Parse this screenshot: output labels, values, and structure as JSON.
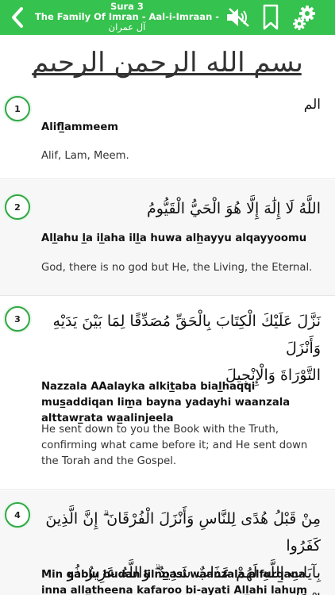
{
  "header": {
    "sura_label": "Sura 3",
    "title_en": "The Family Of Imran - Aal-i-Imraan -",
    "title_ar": "آل عمران",
    "bg_color": "#36c24e"
  },
  "icons": {
    "back": "chevron-left-icon",
    "mute": "speaker-mute-icon",
    "bookmark": "bookmark-icon",
    "settings": "gear-icon"
  },
  "basmala": {
    "text": "بسم الله الرحمن الرحيم"
  },
  "verses": [
    {
      "number": "1",
      "arabic": "الم",
      "transliteration": "Alifl̲ammeem",
      "translation": "Alif, Lam, Meem."
    },
    {
      "number": "2",
      "arabic": "اللَّهُ لَا إِلَٰهَ إِلَّا هُوَ الْحَيُّ الْقَيُّومُ",
      "transliteration": "All̲ahu l̲a il̲aha ill̲a huwa alh̲ayyu alqayyoomu",
      "translation": "God, there is no god but He, the Living, the Eternal."
    },
    {
      "number": "3",
      "arabic_line1": "نَزَّلَ عَلَيْكَ الْكِتَابَ بِالْحَقِّ مُصَدِّقًا لِمَا بَيْنَ يَدَيْهِ وَأَنْزَلَ",
      "arabic_line2": "التَّوْرَاةَ وَالْإِنْجِيلَ",
      "transliteration": "Nazzala AAalayka alkit̲aba bial̲haqqi mus̲addiqan lim̲a bayna yadayhi waanzala alttawr̲ata wa̲alinjeela",
      "translation": "He sent down to you the Book with the Truth, confirming what came before it; and He sent down the Torah and the Gospel."
    },
    {
      "number": "4",
      "arabic_line1": "مِنْ قَبْلُ هُدًى لِلنَّاسِ وَأَنْزَلَ الْفُرْقَانَ ۗ إِنَّ الَّذِينَ كَفَرُوا",
      "arabic_line2": "بِآيَاتِ اللَّهِ لَهُمْ عَذَابٌ شَدِيدٌ ۗ وَاللَّهُ عَزِيزٌ ذُو انْتِقَامٍ",
      "transliteration": "Min qablu hudan lilnn̲asi waanzala alfurq̲ana inna alla̲theena kafaroo bi-ayati All̲ahi lahum AAath̲abun",
      "translation": ""
    }
  ]
}
